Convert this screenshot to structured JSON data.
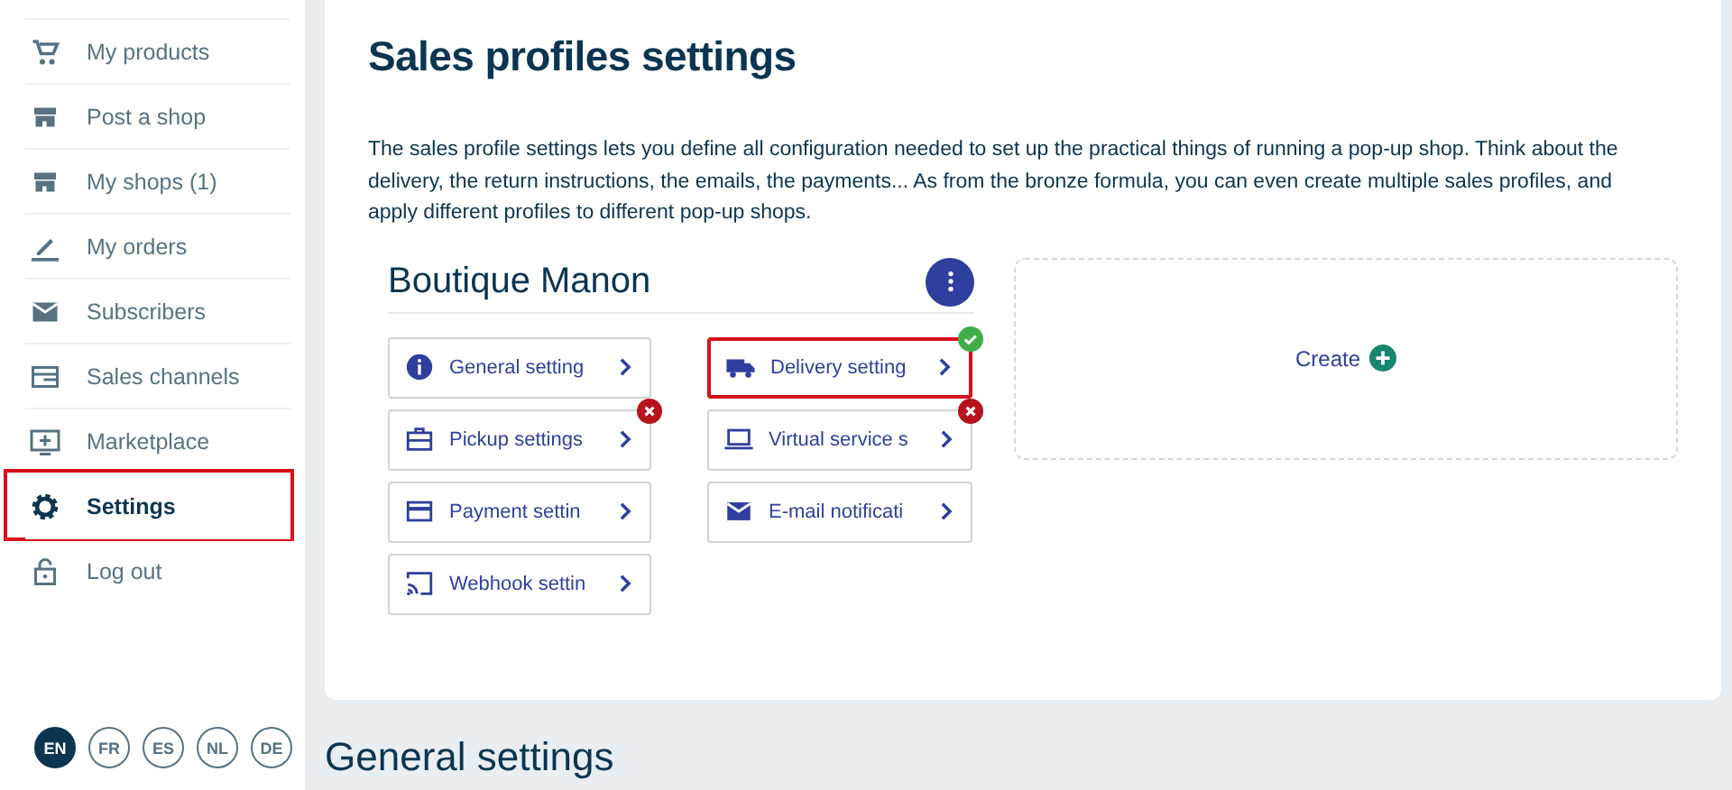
{
  "sidebar": {
    "items": [
      {
        "label": "My products",
        "selected": false
      },
      {
        "label": "Post a shop",
        "selected": false
      },
      {
        "label": "My shops (1)",
        "selected": false
      },
      {
        "label": "My orders",
        "selected": false
      },
      {
        "label": "Subscribers",
        "selected": false
      },
      {
        "label": "Sales channels",
        "selected": false
      },
      {
        "label": "Marketplace",
        "selected": false
      },
      {
        "label": "Settings",
        "selected": true
      },
      {
        "label": "Log out",
        "selected": false
      }
    ],
    "languages": [
      {
        "label": "EN",
        "selected": true
      },
      {
        "label": "FR",
        "selected": false
      },
      {
        "label": "ES",
        "selected": false
      },
      {
        "label": "NL",
        "selected": false
      },
      {
        "label": "DE",
        "selected": false
      }
    ]
  },
  "page": {
    "title": "Sales profiles settings",
    "description": "The sales profile settings lets you define all configuration needed to set up the practical things of running a pop-up shop. Think about the delivery, the return instructions, the emails, the payments... As from the bronze formula, you can even create multiple sales profiles, and apply different profiles to different pop-up shops.",
    "profile": {
      "name": "Boutique Manon",
      "settings": [
        {
          "label": "General setting",
          "selected": false,
          "complete": false,
          "error": false
        },
        {
          "label": "Delivery setting",
          "selected": true,
          "complete": true,
          "error": false
        },
        {
          "label": "Pickup settings",
          "selected": false,
          "complete": false,
          "error": true
        },
        {
          "label": "Virtual service s",
          "selected": false,
          "complete": false,
          "error": true
        },
        {
          "label": "Payment settin",
          "selected": false,
          "complete": false,
          "error": false
        },
        {
          "label": "E-mail notificati",
          "selected": false,
          "complete": false,
          "error": false
        },
        {
          "label": "Webhook settin",
          "selected": false,
          "complete": false,
          "error": false
        }
      ]
    },
    "create_label": "Create",
    "next_section": "General settings"
  }
}
